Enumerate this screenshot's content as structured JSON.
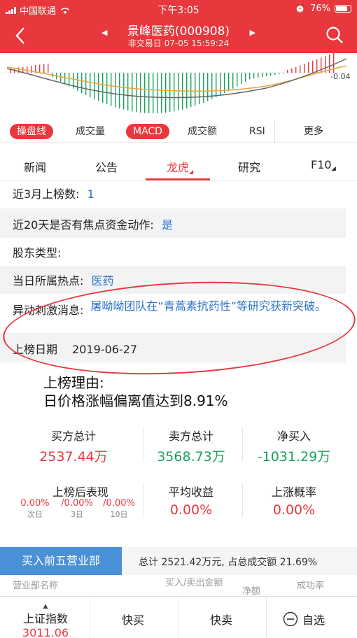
{
  "status": {
    "carrier": "中国联通",
    "time": "下午3:05",
    "battery": "76%"
  },
  "header": {
    "title": "景峰医药(000908)",
    "subtitle": "非交易日 07-05 15:59:24"
  },
  "chart": {
    "axis_value": "-0.04"
  },
  "indicators": [
    "操盘线",
    "成交量",
    "MACD",
    "成交额",
    "RSI"
  ],
  "indicators_more": "更多",
  "tabs": {
    "news": "新闻",
    "notice": "公告",
    "dragon": "龙虎",
    "research": "研究",
    "f10": "F10"
  },
  "info": {
    "listed_count_label": "近3月上榜数:",
    "listed_count_value": "1",
    "focus_label": "近20天是否有焦点资金动作:",
    "focus_value": "是",
    "holder_label": "股东类型:",
    "hot_label": "当日所属热点:",
    "hot_value": "医药",
    "news_label": "异动刺激消息:",
    "news_value": "屠呦呦团队在“青蒿素抗药性”等研究获新突破。",
    "date_label": "上榜日期",
    "date_value": "2019-06-27"
  },
  "reason": {
    "label": "上榜理由:",
    "text": "日价格涨幅偏离值达到8.91%"
  },
  "trade": {
    "buy_label": "买方总计",
    "buy_value": "2537.44万",
    "sell_label": "卖方总计",
    "sell_value": "3568.73万",
    "net_label": "净买入",
    "net_value": "-1031.29万"
  },
  "perf": {
    "after_label": "上榜后表现",
    "d1": "0.00%",
    "d1_label": "次日",
    "d3": "/0.00%",
    "d3_label": "3日",
    "d10": "/0.00%",
    "d10_label": "10日",
    "avg_label": "平均收益",
    "avg_value": "0.00%",
    "prob_label": "上涨概率",
    "prob_value": "0.00%"
  },
  "section": {
    "button": "买入前五营业部",
    "summary": "总计 2521.42万元, 占总成交额 21.69%"
  },
  "table_head": {
    "c1": "营业部名称",
    "c2": "买入/卖出金额",
    "c3": "净额",
    "c4": "成功率"
  },
  "bottom": {
    "index_name": "上证指数",
    "index_value": "3011.06",
    "quick_buy": "快买",
    "quick_sell": "快卖",
    "watch": "自选"
  },
  "colors": {
    "brand": "#e8383d",
    "up": "#e8383d",
    "down": "#1aa35a",
    "link": "#2a72c8"
  },
  "icons": [
    "wifi-icon",
    "back-icon",
    "search-icon",
    "minus-circle-icon"
  ]
}
